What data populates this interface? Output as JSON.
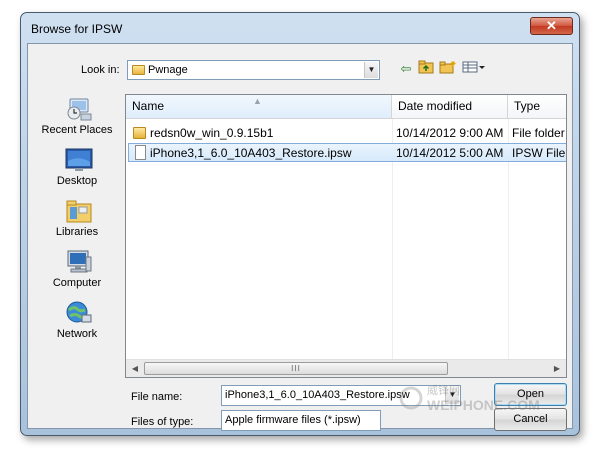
{
  "window": {
    "title": "Browse for IPSW",
    "close_glyph": "✕"
  },
  "lookin": {
    "label": "Look in:",
    "value": "Pwnage",
    "icon": "folder-icon"
  },
  "toolbar": {
    "icons": [
      "back-arrow-icon",
      "up-folder-icon",
      "new-folder-icon",
      "view-menu-icon"
    ]
  },
  "places": [
    {
      "label": "Recent Places",
      "icon": "recent-places-icon"
    },
    {
      "label": "Desktop",
      "icon": "desktop-icon"
    },
    {
      "label": "Libraries",
      "icon": "libraries-icon"
    },
    {
      "label": "Computer",
      "icon": "computer-icon"
    },
    {
      "label": "Network",
      "icon": "network-icon"
    }
  ],
  "filelist": {
    "columns": [
      "Name",
      "Date modified",
      "Type"
    ],
    "rows": [
      {
        "name": "redsn0w_win_0.9.15b1",
        "date": "10/14/2012 9:00 AM",
        "type": "File folder",
        "icon": "folder-icon",
        "selected": false
      },
      {
        "name": "iPhone3,1_6.0_10A403_Restore.ipsw",
        "date": "10/14/2012 5:00 AM",
        "type": "IPSW File",
        "icon": "file-icon",
        "selected": true
      }
    ],
    "scroll_grip": "III"
  },
  "filename": {
    "label": "File name:",
    "value": "iPhone3,1_6.0_10A403_Restore.ipsw"
  },
  "filetype": {
    "label": "Files of type:",
    "value": "Apple firmware files (*.ipsw)"
  },
  "buttons": {
    "open": "Open",
    "cancel": "Cancel"
  },
  "watermark": {
    "text": "WEIPHONE.COM",
    "cn": "威锋网"
  },
  "colors": {
    "selection": "#d6eafc",
    "selection_border": "#84acdd",
    "frame": "#b7cde4",
    "close": "#c2391f"
  }
}
